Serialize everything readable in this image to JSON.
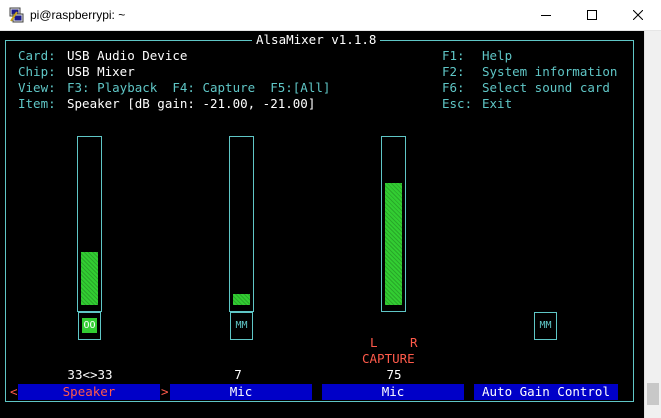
{
  "window": {
    "title": "pi@raspberrypi: ~",
    "icon": "putty-icon",
    "controls": [
      "minimize-icon",
      "maximize-icon",
      "close-icon"
    ]
  },
  "mixer": {
    "frame_title": "AlsaMixer v1.1.8",
    "card_label": "Card:",
    "card_value": "USB Audio Device",
    "chip_label": "Chip:",
    "chip_value": "USB Mixer",
    "view_label": "View:",
    "view_value": "F3: Playback  F4: Capture  F5:[All]",
    "item_label": "Item:",
    "item_value": "Speaker [dB gain: -21.00, -21.00]",
    "keys": [
      {
        "key": "F1:",
        "action": "Help"
      },
      {
        "key": "F2:",
        "action": "System information"
      },
      {
        "key": "F6:",
        "action": "Select sound card"
      },
      {
        "key": "Esc:",
        "action": "Exit"
      }
    ]
  },
  "channels": [
    {
      "name": "Speaker",
      "volume_text": "33<>33",
      "level": 0.33,
      "switch": "OO",
      "switch_on": true,
      "selected": true,
      "left_arrow": "<",
      "right_arrow": ">"
    },
    {
      "name": "Mic",
      "volume_text": "7",
      "level": 0.07,
      "switch": "MM",
      "switch_on": false,
      "selected": false
    },
    {
      "name": "Mic",
      "volume_text": "75",
      "level": 0.75,
      "capture_l": "L",
      "capture_r": "R",
      "capture_label": "CAPTURE",
      "selected": false
    },
    {
      "name": "Auto Gain Control",
      "switch": "MM",
      "switch_on": false,
      "selected": false
    }
  ],
  "colors": {
    "frame": "#5fc6c6",
    "bar_green": "#32cd32",
    "name_bg": "#0000c8",
    "selected_red": "#ff5a4a"
  }
}
